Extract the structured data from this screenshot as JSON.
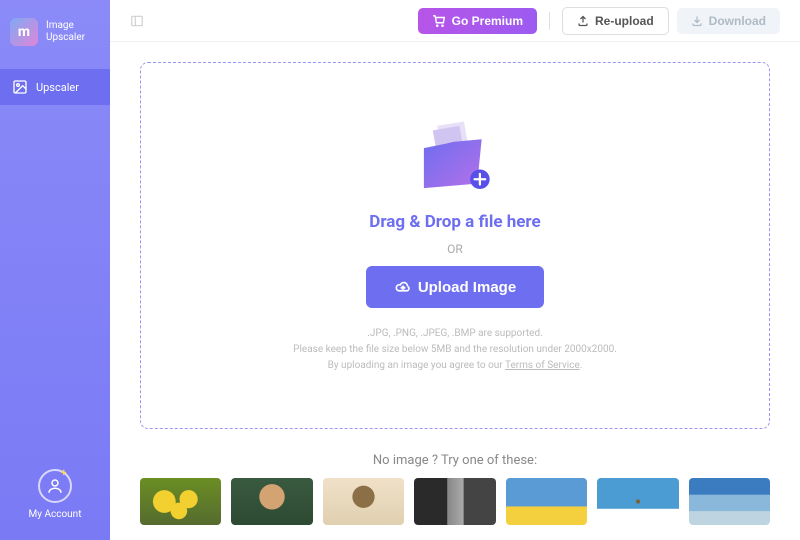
{
  "app": {
    "name_line1": "Image",
    "name_line2": "Upscaler",
    "logo_letter": "m"
  },
  "sidebar": {
    "nav_item": "Upscaler",
    "account": "My Account"
  },
  "topbar": {
    "premium": "Go Premium",
    "reupload": "Re-upload",
    "download": "Download"
  },
  "dropzone": {
    "title": "Drag & Drop a file here",
    "or": "OR",
    "upload_btn": "Upload Image",
    "note1": ".JPG, .PNG, .JPEG, .BMP are supported.",
    "note2": "Please keep the file size below 5MB and the resolution under 2000x2000.",
    "note3_prefix": "By uploading an image you agree to our ",
    "tos": "Terms of Service"
  },
  "samples": {
    "title": "No image ? Try one of these:"
  }
}
